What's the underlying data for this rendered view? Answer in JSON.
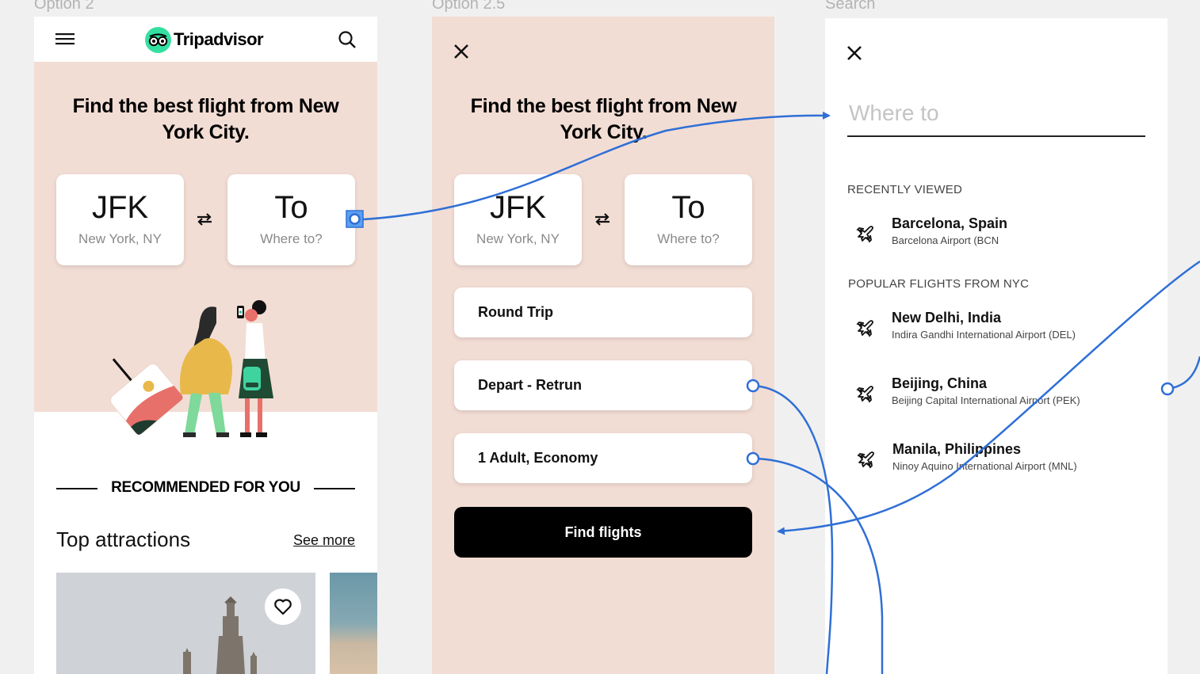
{
  "labels": {
    "frame1": "Option 2",
    "frame2": "Option 2.5",
    "frame3": "Search"
  },
  "colors": {
    "hero_bg": "#f2ddd4",
    "connector": "#2f6fd6",
    "logo_green": "#34e0a1",
    "button_black": "#000000"
  },
  "frame1": {
    "brand": "Tripadvisor",
    "heading": "Find the best flight from New York City.",
    "from": {
      "code": "JFK",
      "city": "New York, NY"
    },
    "to": {
      "code": "To",
      "city": "Where to?"
    },
    "recommended": "RECOMMENDED FOR YOU",
    "attractions_title": "Top attractions",
    "see_more": "See more"
  },
  "frame2": {
    "heading": "Find the best flight from New York City.",
    "from": {
      "code": "JFK",
      "city": "New York, NY"
    },
    "to": {
      "code": "To",
      "city": "Where to?"
    },
    "trip_type": "Round Trip",
    "dates": "Depart - Retrun",
    "travelers": "1 Adult, Economy",
    "find_button": "Find flights"
  },
  "frame3": {
    "placeholder": "Where to",
    "recent_label": "RECENTLY VIEWED",
    "recent": [
      {
        "city": "Barcelona, Spain",
        "airport": "Barcelona Airport (BCN"
      }
    ],
    "popular_label": "POPULAR FLIGHTS FROM NYC",
    "popular": [
      {
        "city": "New Delhi, India",
        "airport": "Indira Gandhi International Airport (DEL)"
      },
      {
        "city": "Beijing, China",
        "airport": "Beijing Capital International Airport (PEK)"
      },
      {
        "city": "Manila, Philippines",
        "airport": "Ninoy Aquino International Airport (MNL)"
      }
    ]
  }
}
